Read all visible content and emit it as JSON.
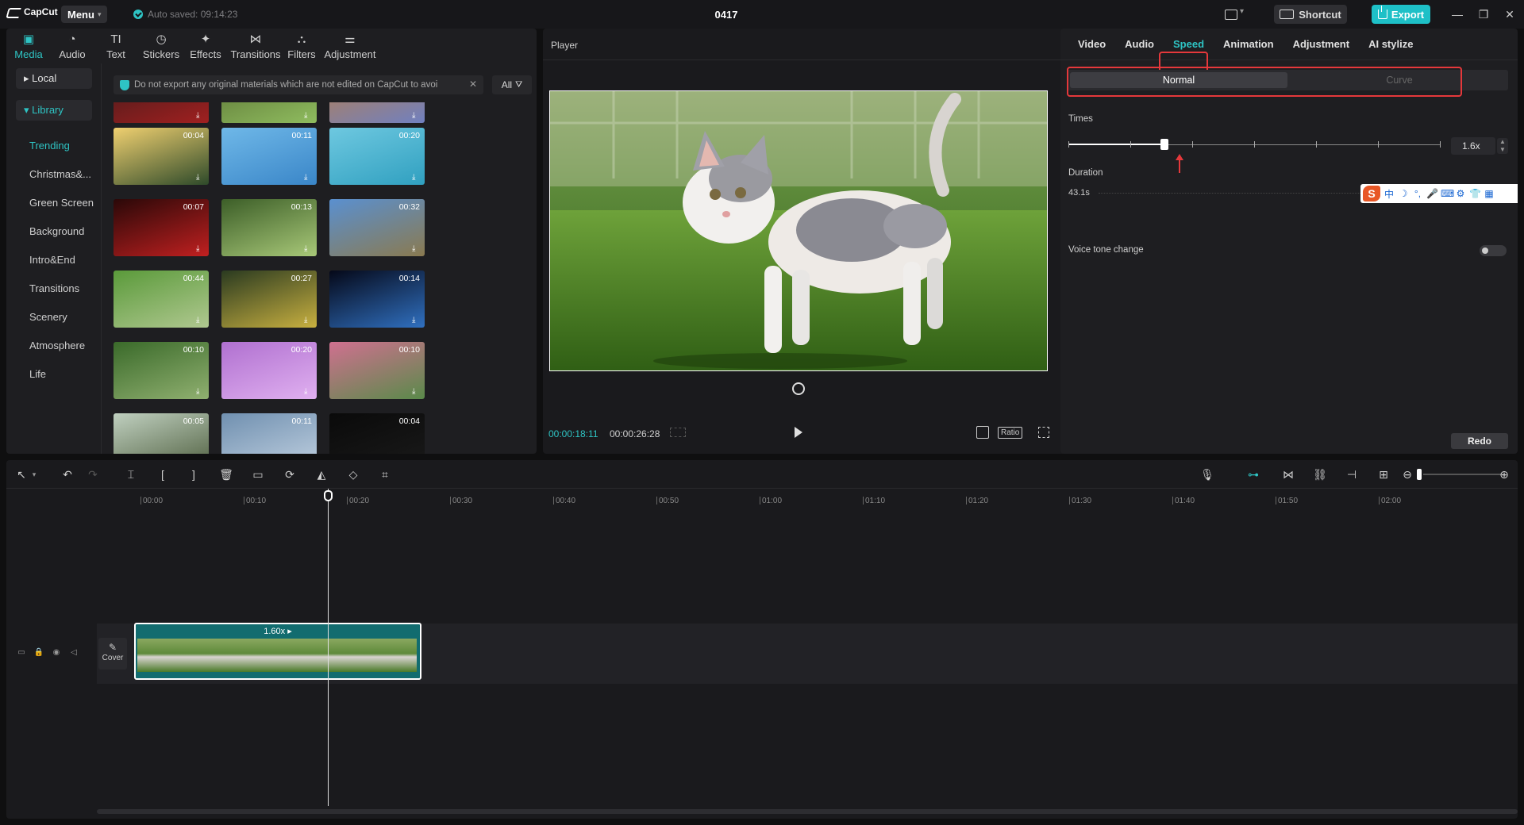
{
  "titlebar": {
    "app_name": "CapCut",
    "menu_label": "Menu",
    "autosave": "Auto saved: 09:14:23",
    "project_title": "0417",
    "shortcut_label": "Shortcut",
    "export_label": "Export",
    "minimize": "—",
    "maximize": "❐",
    "close": "✕"
  },
  "media_tabs": [
    {
      "label": "Media",
      "icon": "media-icon"
    },
    {
      "label": "Audio",
      "icon": "audio-icon"
    },
    {
      "label": "Text",
      "icon": "text-icon"
    },
    {
      "label": "Stickers",
      "icon": "stickers-icon"
    },
    {
      "label": "Effects",
      "icon": "effects-icon"
    },
    {
      "label": "Transitions",
      "icon": "transitions-icon"
    },
    {
      "label": "Filters",
      "icon": "filters-icon"
    },
    {
      "label": "Adjustment",
      "icon": "adjustment-icon"
    }
  ],
  "sidebar": {
    "local": "▸ Local",
    "library": "▾ Library",
    "items": [
      "Trending",
      "Christmas&...",
      "Green Screen",
      "Background",
      "Intro&End",
      "Transitions",
      "Scenery",
      "Atmosphere",
      "Life"
    ]
  },
  "notice": {
    "text": "Do not export any original materials which are not edited on CapCut to avoi",
    "close": "✕"
  },
  "filter": {
    "label": "All"
  },
  "thumbnails": [
    {
      "dur": "",
      "colors": [
        "#3a1a1a",
        "#a02020"
      ]
    },
    {
      "dur": "",
      "colors": [
        "#556b2f",
        "#8fbc5f"
      ]
    },
    {
      "dur": "",
      "colors": [
        "#c08040",
        "#7080c0"
      ]
    },
    {
      "dur": "00:04",
      "colors": [
        "#f0d070",
        "#2e4a2a"
      ]
    },
    {
      "dur": "00:11",
      "colors": [
        "#6fb8e8",
        "#3a86c8"
      ]
    },
    {
      "dur": "00:20",
      "colors": [
        "#6ec8e0",
        "#30a0c0"
      ]
    },
    {
      "dur": "00:07",
      "colors": [
        "#2a0808",
        "#c02020"
      ]
    },
    {
      "dur": "00:13",
      "colors": [
        "#3c5e28",
        "#a8c878"
      ]
    },
    {
      "dur": "00:32",
      "colors": [
        "#5a90d0",
        "#8a7a50"
      ]
    },
    {
      "dur": "00:44",
      "colors": [
        "#5a9a3a",
        "#b0c890"
      ]
    },
    {
      "dur": "00:27",
      "colors": [
        "#2a3a20",
        "#c8b040"
      ]
    },
    {
      "dur": "00:14",
      "colors": [
        "#050818",
        "#3070c0"
      ]
    },
    {
      "dur": "00:10",
      "colors": [
        "#3a6a2a",
        "#90b070"
      ]
    },
    {
      "dur": "00:20",
      "colors": [
        "#b070d0",
        "#e0b0f0"
      ]
    },
    {
      "dur": "00:10",
      "colors": [
        "#d07090",
        "#5a8a4a"
      ]
    },
    {
      "dur": "00:05",
      "colors": [
        "#c0d0c0",
        "#506040"
      ]
    },
    {
      "dur": "00:11",
      "colors": [
        "#7090b0",
        "#c0d0e0"
      ]
    },
    {
      "dur": "00:04",
      "colors": [
        "#0a0a0a",
        "#1a1a1a"
      ]
    }
  ],
  "player": {
    "title": "Player",
    "current_time": "00:00:18:11",
    "total_time": "00:00:26:28",
    "ratio_label": "Ratio"
  },
  "properties": {
    "tabs": [
      "Video",
      "Audio",
      "Speed",
      "Animation",
      "Adjustment",
      "AI stylize"
    ],
    "active_tab": "Speed",
    "mode_normal": "Normal",
    "mode_curve": "Curve",
    "times_label": "Times",
    "times_value": "1.6x",
    "speed_level_fraction": 0.258,
    "duration_label": "Duration",
    "duration_value": "43.1s",
    "voice_label": "Voice tone change",
    "redo_label": "Redo",
    "ime": {
      "logo": "S",
      "chars": [
        "中",
        "☽",
        "°,",
        "🎤",
        "⌨",
        "⚙",
        "👕",
        "▦"
      ]
    }
  },
  "timeline": {
    "ruler": [
      "00:00",
      "00:10",
      "00:20",
      "00:30",
      "00:40",
      "00:50",
      "01:00",
      "01:10",
      "01:20",
      "01:30",
      "01:40",
      "01:50",
      "02:00"
    ],
    "clip_label": "1.60x ▸",
    "cover_label": "Cover"
  },
  "colors": {
    "accent": "#2ec4c4",
    "highlight": "#e5383b",
    "panel": "#1e1e21",
    "clip": "#126c6f"
  }
}
